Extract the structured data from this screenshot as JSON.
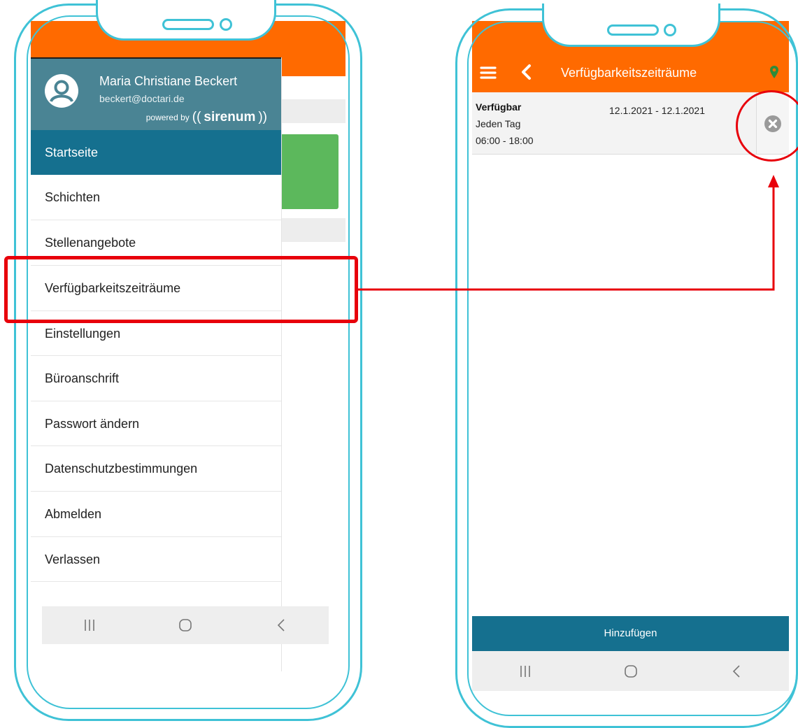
{
  "left_phone": {
    "user": {
      "name": "Maria Christiane Beckert",
      "email": "beckert@doctari.de"
    },
    "powered_by": {
      "label": "powered by",
      "open": "((",
      "brand": "sirenum",
      "close": "))"
    },
    "menu": [
      {
        "label": "Startseite",
        "active": true
      },
      {
        "label": "Schichten"
      },
      {
        "label": "Stellenangebote"
      },
      {
        "label": "Verfügbarkeitszeiträume",
        "highlighted": true
      },
      {
        "label": "Einstellungen"
      },
      {
        "label": "Büroanschrift"
      },
      {
        "label": "Passwort ändern"
      },
      {
        "label": "Datenschutzbestimmungen"
      },
      {
        "label": "Abmelden"
      },
      {
        "label": "Verlassen"
      }
    ]
  },
  "right_phone": {
    "header": {
      "title": "Verfügbarkeitszeiträume"
    },
    "entry": {
      "status": "Verfügbar",
      "recurrence": "Jeden Tag",
      "time": "06:00 - 18:00",
      "date_range": "12.1.2021 - 12.1.2021"
    },
    "add_button": {
      "label": "Hinzufügen"
    }
  },
  "colors": {
    "header_orange": "#ff6a00",
    "drawer_header": "#4a8494",
    "active_item": "#15708f",
    "add_button": "#15708f",
    "frame": "#3fc2d6",
    "annotation_red": "#e8000b",
    "green_tile": "#5cb85c"
  }
}
